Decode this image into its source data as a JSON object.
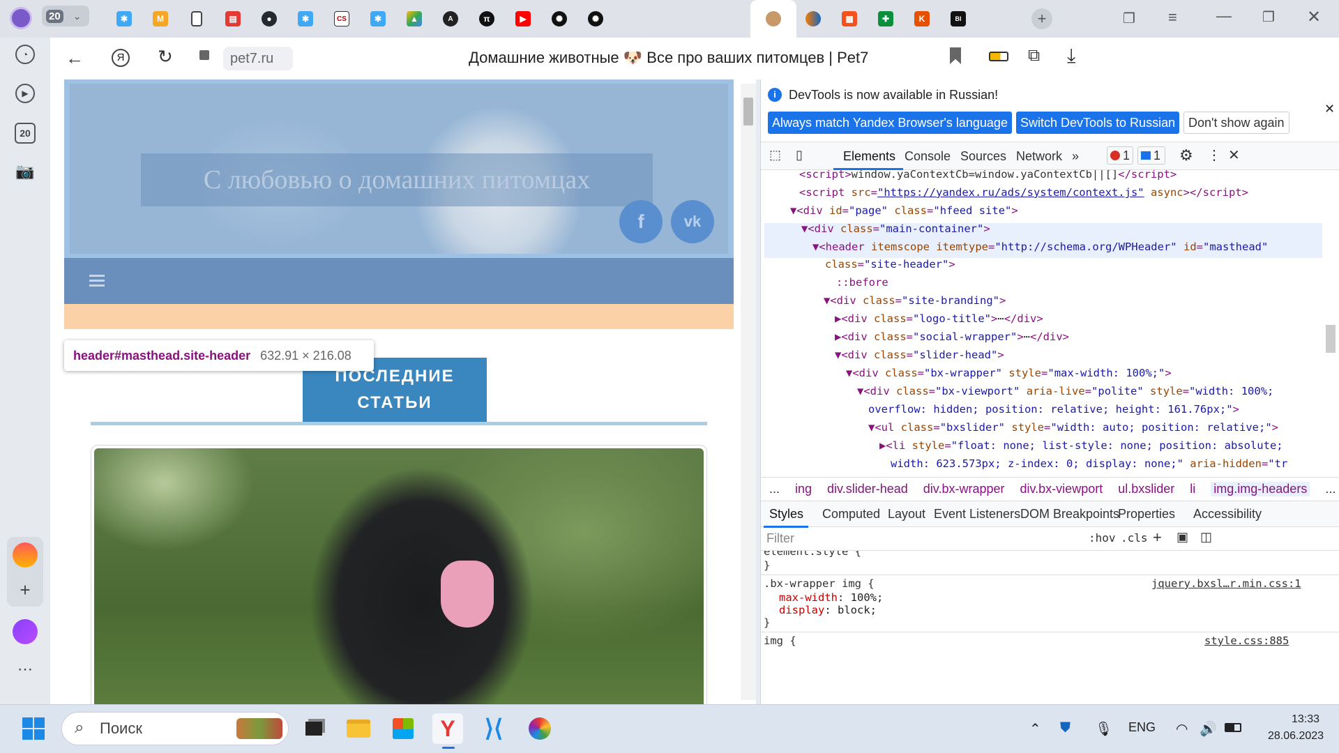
{
  "browser": {
    "tab_count": "20",
    "page_title": "Домашние животные 🐶 Все про ваших питомцев | Pet7",
    "url": "pet7.ru",
    "sidebar_badge": "20"
  },
  "site": {
    "hero_title": "С любовью о домашних питомцах",
    "social_fb": "f",
    "social_vk": "vk",
    "section_button_line1": "ПОСЛЕДНИЕ",
    "section_button_line2": "СТАТЬИ"
  },
  "tooltip": {
    "selector": "header#masthead.site-header",
    "size": "632.91 × 216.08"
  },
  "devtools": {
    "info_text": "DevTools is now available in Russian!",
    "btn_match": "Always match Yandex Browser's language",
    "btn_switch": "Switch DevTools to Russian",
    "btn_dismiss": "Don't show again",
    "tabs": [
      "Elements",
      "Console",
      "Sources",
      "Network",
      "»"
    ],
    "error_count": "1",
    "message_count": "1",
    "breadcrumbs": [
      "...",
      "ing",
      "div.slider-head",
      "div.bx-wrapper",
      "div.bx-viewport",
      "ul.bxslider",
      "li",
      "img.img-headers",
      "..."
    ],
    "subtabs": [
      "Styles",
      "Computed",
      "Layout",
      "Event Listeners",
      "DOM Breakpoints",
      "Properties",
      "Accessibility"
    ],
    "filter_placeholder": "Filter",
    "filter_hov": ":hov",
    "filter_cls": ".cls",
    "style_rules": {
      "r1_selector": "element.style {",
      "r1_close": "}",
      "r2_selector": ".bx-wrapper img {",
      "r2_source": "jquery.bxsl…r.min.css:1",
      "r2_p1_name": "max-width",
      "r2_p1_val": "100%;",
      "r2_p2_name": "display",
      "r2_p2_val": "block;",
      "r2_close": "}",
      "r3_selector": "img {",
      "r3_source": "style.css:885"
    }
  },
  "taskbar": {
    "search_placeholder": "Поиск",
    "lang": "ENG",
    "time": "13:33",
    "date": "28.06.2023"
  }
}
